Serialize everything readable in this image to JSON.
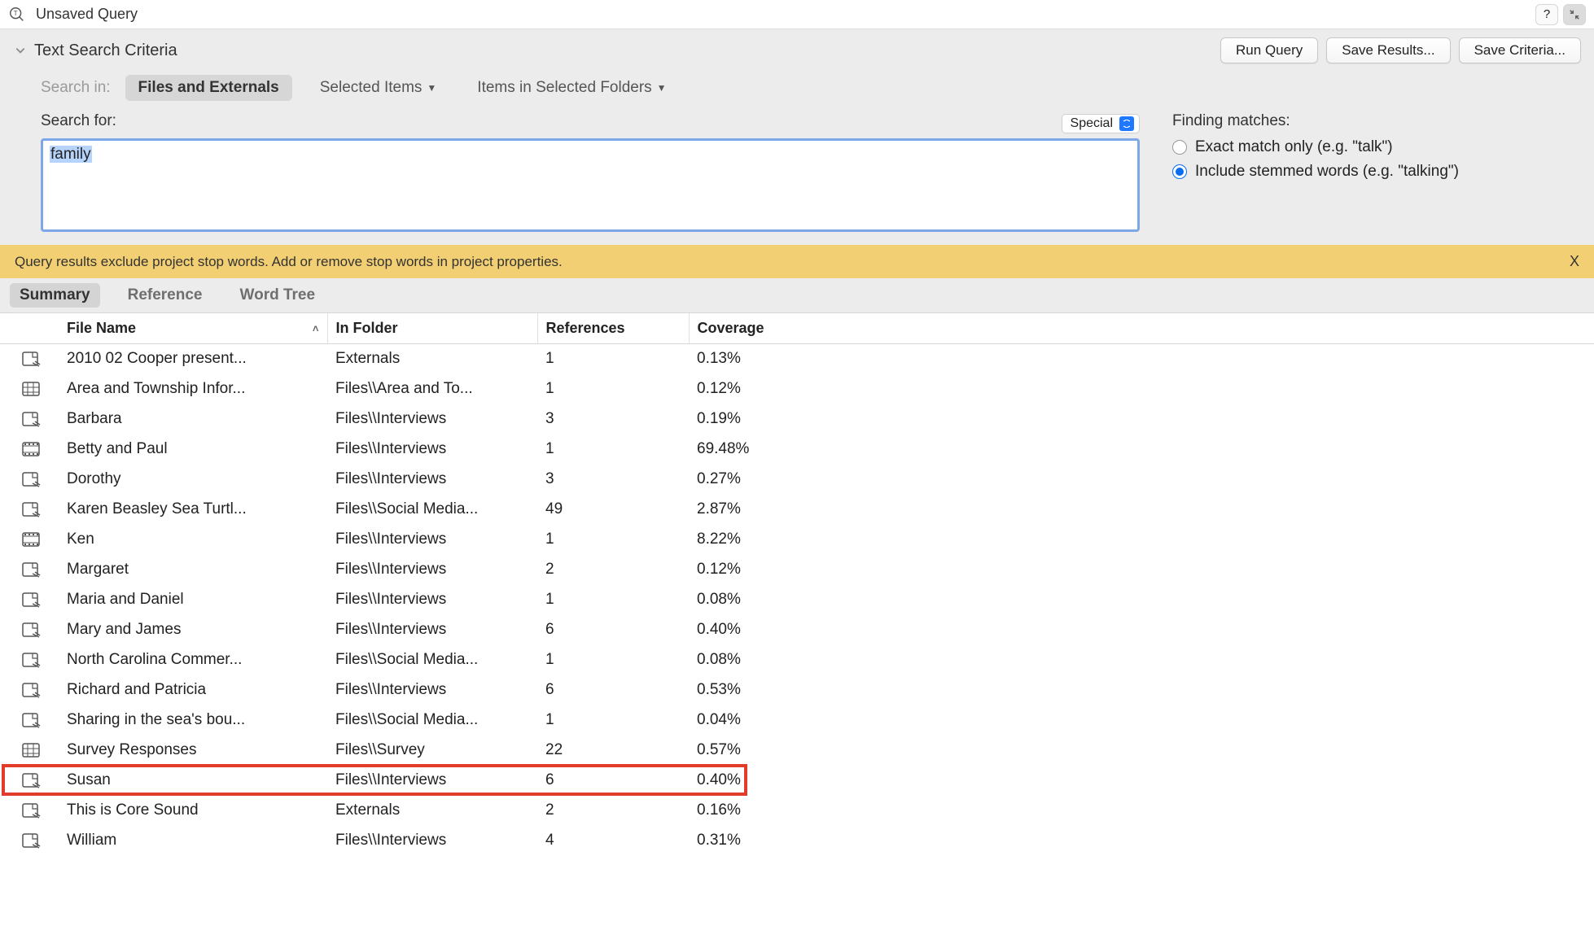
{
  "titlebar": {
    "title": "Unsaved Query",
    "help_symbol": "?"
  },
  "criteria": {
    "header": "Text Search Criteria",
    "run_query": "Run Query",
    "save_results": "Save Results...",
    "save_criteria": "Save Criteria...",
    "search_in_label": "Search in:",
    "scopes": {
      "files_externals": "Files and Externals",
      "selected_items": "Selected Items",
      "items_in_folders": "Items in Selected Folders"
    },
    "search_for_label": "Search for:",
    "special_label": "Special",
    "search_term": "family",
    "matches": {
      "title": "Finding matches:",
      "exact": "Exact match only (e.g. \"talk\")",
      "stemmed": "Include stemmed words (e.g. \"talking\")",
      "selected": "stemmed"
    }
  },
  "banner": {
    "text": "Query results exclude project stop words. Add or remove stop words in project properties.",
    "close": "X"
  },
  "tabs": {
    "summary": "Summary",
    "reference": "Reference",
    "word_tree": "Word Tree"
  },
  "columns": {
    "file_name": "File Name",
    "in_folder": "In Folder",
    "references": "References",
    "coverage": "Coverage"
  },
  "rows": [
    {
      "icon": "doc",
      "name": "2010 02 Cooper present...",
      "folder": "Externals",
      "refs": "1",
      "cov": "0.13%"
    },
    {
      "icon": "grid",
      "name": "Area and Township Infor...",
      "folder": "Files\\\\Area and To...",
      "refs": "1",
      "cov": "0.12%"
    },
    {
      "icon": "doc",
      "name": "Barbara",
      "folder": "Files\\\\Interviews",
      "refs": "3",
      "cov": "0.19%"
    },
    {
      "icon": "video",
      "name": "Betty and Paul",
      "folder": "Files\\\\Interviews",
      "refs": "1",
      "cov": "69.48%"
    },
    {
      "icon": "doc",
      "name": "Dorothy",
      "folder": "Files\\\\Interviews",
      "refs": "3",
      "cov": "0.27%"
    },
    {
      "icon": "doc",
      "name": "Karen Beasley Sea Turtl...",
      "folder": "Files\\\\Social Media...",
      "refs": "49",
      "cov": "2.87%"
    },
    {
      "icon": "video",
      "name": "Ken",
      "folder": "Files\\\\Interviews",
      "refs": "1",
      "cov": "8.22%"
    },
    {
      "icon": "doc",
      "name": "Margaret",
      "folder": "Files\\\\Interviews",
      "refs": "2",
      "cov": "0.12%"
    },
    {
      "icon": "doc",
      "name": "Maria and Daniel",
      "folder": "Files\\\\Interviews",
      "refs": "1",
      "cov": "0.08%"
    },
    {
      "icon": "doc",
      "name": "Mary and James",
      "folder": "Files\\\\Interviews",
      "refs": "6",
      "cov": "0.40%"
    },
    {
      "icon": "doc",
      "name": "North Carolina Commer...",
      "folder": "Files\\\\Social Media...",
      "refs": "1",
      "cov": "0.08%"
    },
    {
      "icon": "doc",
      "name": "Richard and Patricia",
      "folder": "Files\\\\Interviews",
      "refs": "6",
      "cov": "0.53%"
    },
    {
      "icon": "doc",
      "name": "Sharing in the sea's bou...",
      "folder": "Files\\\\Social Media...",
      "refs": "1",
      "cov": "0.04%"
    },
    {
      "icon": "grid",
      "name": "Survey Responses",
      "folder": "Files\\\\Survey",
      "refs": "22",
      "cov": "0.57%"
    },
    {
      "icon": "doc",
      "name": "Susan",
      "folder": "Files\\\\Interviews",
      "refs": "6",
      "cov": "0.40%",
      "highlight": true
    },
    {
      "icon": "doc",
      "name": "This is Core Sound",
      "folder": "Externals",
      "refs": "2",
      "cov": "0.16%"
    },
    {
      "icon": "doc",
      "name": "William",
      "folder": "Files\\\\Interviews",
      "refs": "4",
      "cov": "0.31%"
    }
  ],
  "icons": {
    "doc": "doc-icon",
    "grid": "grid-icon",
    "video": "video-icon"
  }
}
